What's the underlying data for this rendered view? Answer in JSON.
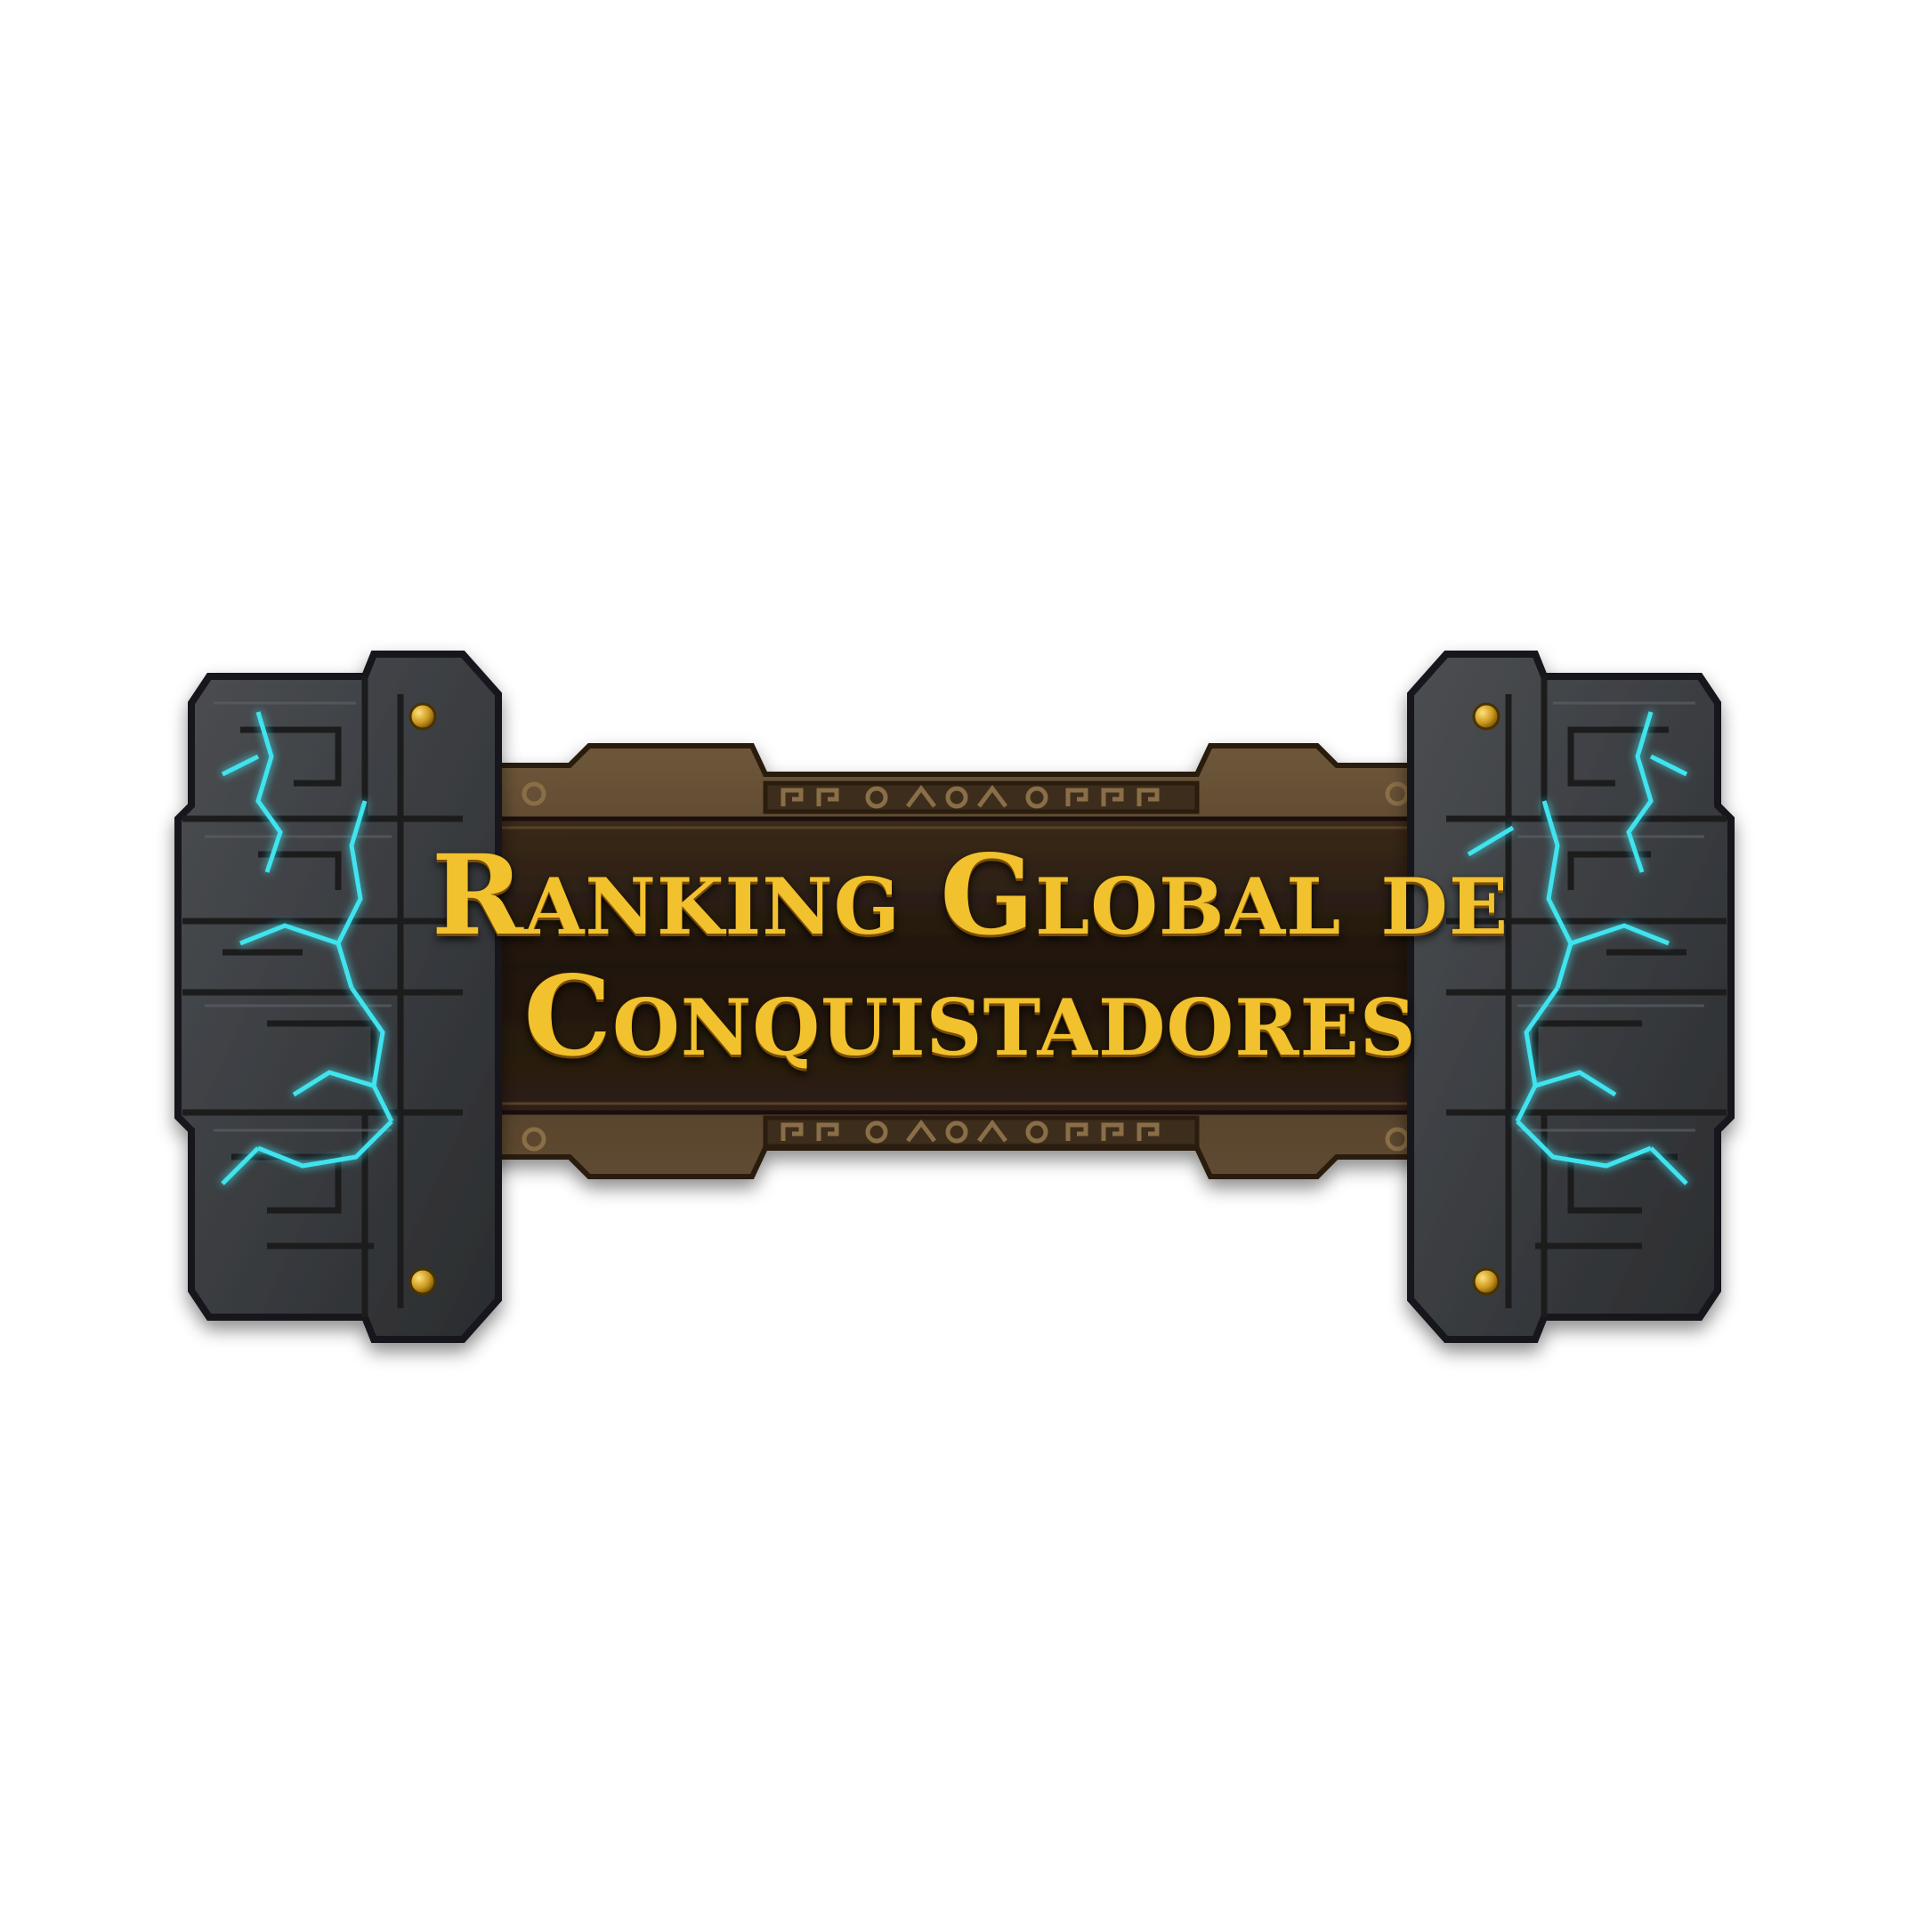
{
  "banner": {
    "title_line_1": "Ranking Global de",
    "title_line_2": "Conquistadores"
  },
  "colors": {
    "title_gold": "#f2c12e",
    "stone_dark": "#2f3134",
    "stone_light": "#44474b",
    "plank_brown": "#2a1d12",
    "ornament_bronze": "#6b5234",
    "energy_cyan": "#3fe3ee",
    "rivet_gold": "#c9961e"
  },
  "icons": {
    "left_pillar": "stone-pillar-icon",
    "right_pillar": "stone-pillar-icon",
    "rivet": "gold-rivet-icon",
    "crack": "glowing-crack-icon",
    "ornament": "meander-ornament-icon"
  }
}
